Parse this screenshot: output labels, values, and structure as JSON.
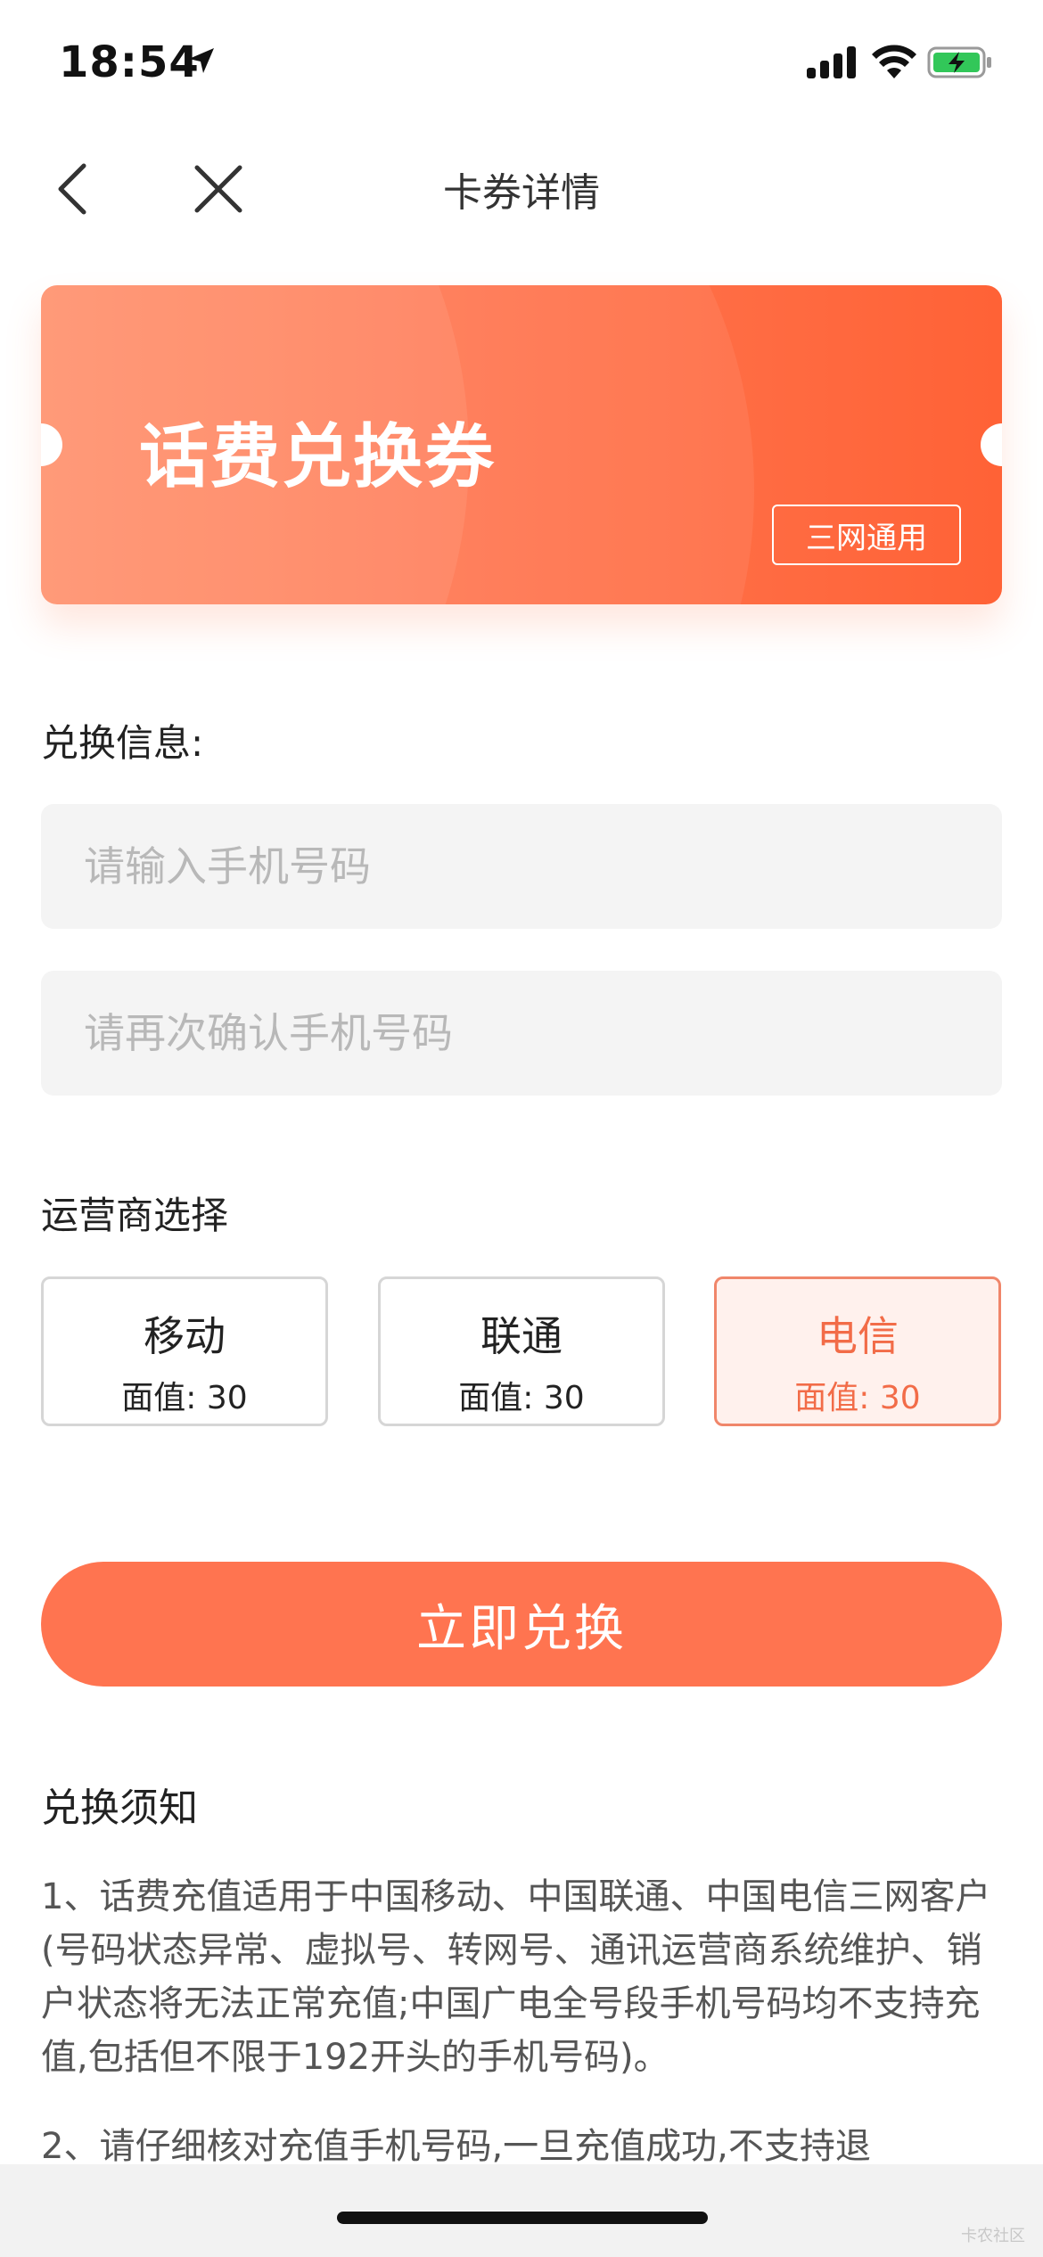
{
  "status_bar": {
    "time": "18:54"
  },
  "nav": {
    "title": "卡券详情"
  },
  "coupon": {
    "title": "话费兑换券",
    "tag": "三网通用"
  },
  "exchange_info": {
    "label": "兑换信息:",
    "phone_placeholder": "请输入手机号码",
    "confirm_placeholder": "请再次确认手机号码"
  },
  "carrier_section": {
    "label": "运营商选择",
    "options": [
      {
        "name": "移动",
        "value": "面值: 30",
        "selected": false
      },
      {
        "name": "联通",
        "value": "面值: 30",
        "selected": false
      },
      {
        "name": "电信",
        "value": "面值: 30",
        "selected": true
      }
    ]
  },
  "redeem_button": "立即兑换",
  "notice": {
    "title": "兑换须知",
    "items": [
      "1、话费充值适用于中国移动、中国联通、中国电信三网客户(号码状态异常、虚拟号、转网号、通讯运营商系统维护、销户状态将无法正常充值;中国广电全号段手机号码均不支持充值,包括但不限于192开头的手机号码)。",
      "2、请仔细核对充值手机号码,一旦充值成功,不支持退"
    ]
  },
  "watermark": "卡农社区",
  "colors": {
    "accent": "#ff7450",
    "selected_border": "#f0866a",
    "selected_bg": "#fff1ed",
    "input_bg": "#f4f4f4"
  }
}
